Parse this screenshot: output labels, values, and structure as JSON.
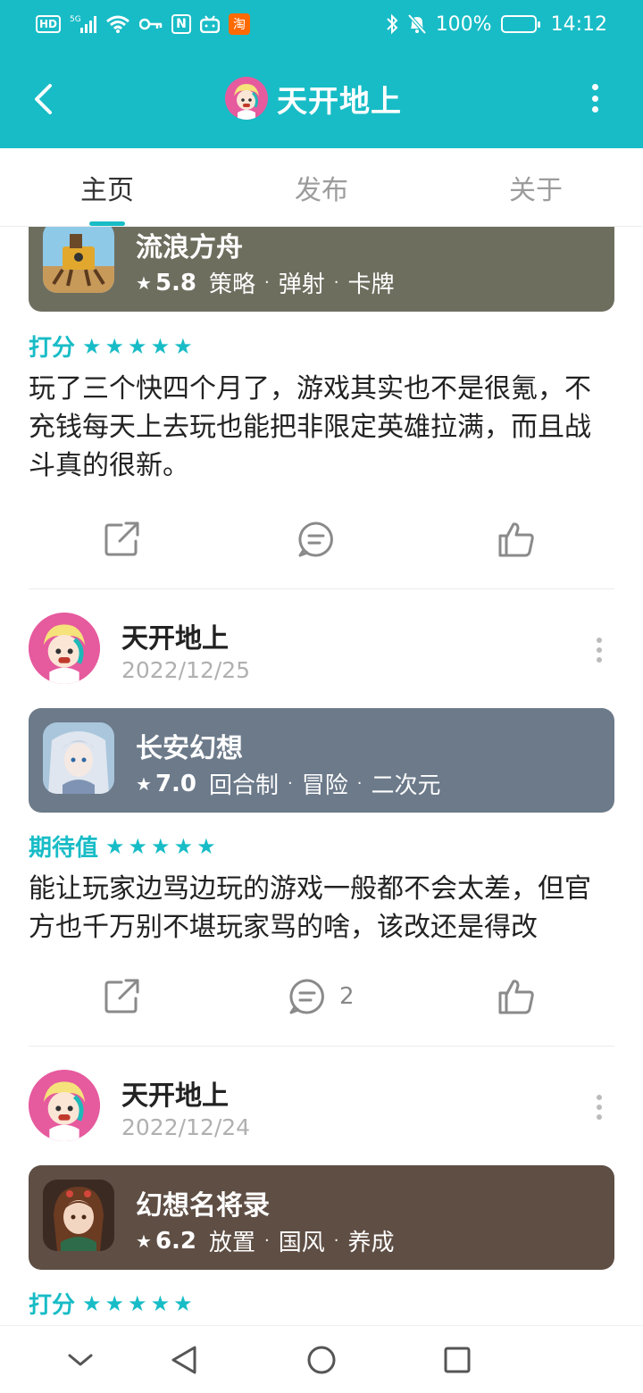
{
  "status_bar": {
    "hd": "HD",
    "network": "5G",
    "nfc": "N",
    "taobao": "淘",
    "battery": "100%",
    "time": "14:12"
  },
  "header": {
    "title": "天开地上",
    "icons": {
      "back": "chevron-left-icon",
      "more": "more-vertical-icon"
    }
  },
  "tabs": [
    {
      "label": "主页",
      "active": true
    },
    {
      "label": "发布",
      "active": false
    },
    {
      "label": "关于",
      "active": false
    }
  ],
  "posts": [
    {
      "game": {
        "name": "流浪方舟",
        "score": "5.8",
        "tags": [
          "策略",
          "弹射",
          "卡牌"
        ],
        "color": "#6e6e5f"
      },
      "rating_label": "打分",
      "stars": 5,
      "text": "玩了三个快四个月了，游戏其实也不是很氪，不充钱每天上去玩也能把非限定英雄拉满，而且战斗真的很新。",
      "comments": ""
    },
    {
      "author": "天开地上",
      "date": "2022/12/25",
      "game": {
        "name": "长安幻想",
        "score": "7.0",
        "tags": [
          "回合制",
          "冒险",
          "二次元"
        ],
        "color": "#6c7a8a"
      },
      "rating_label": "期待值",
      "stars": 5,
      "text": "能让玩家边骂边玩的游戏一般都不会太差，但官方也千万别不堪玩家骂的啥，该改还是得改",
      "comments": "2"
    },
    {
      "author": "天开地上",
      "date": "2022/12/24",
      "game": {
        "name": "幻想名将录",
        "score": "6.2",
        "tags": [
          "放置",
          "国风",
          "养成"
        ],
        "color": "#5e4e44"
      },
      "rating_label": "打分",
      "stars": 5
    }
  ],
  "colors": {
    "accent": "#18bcc6",
    "avatar_bg": "#e65a9e"
  }
}
